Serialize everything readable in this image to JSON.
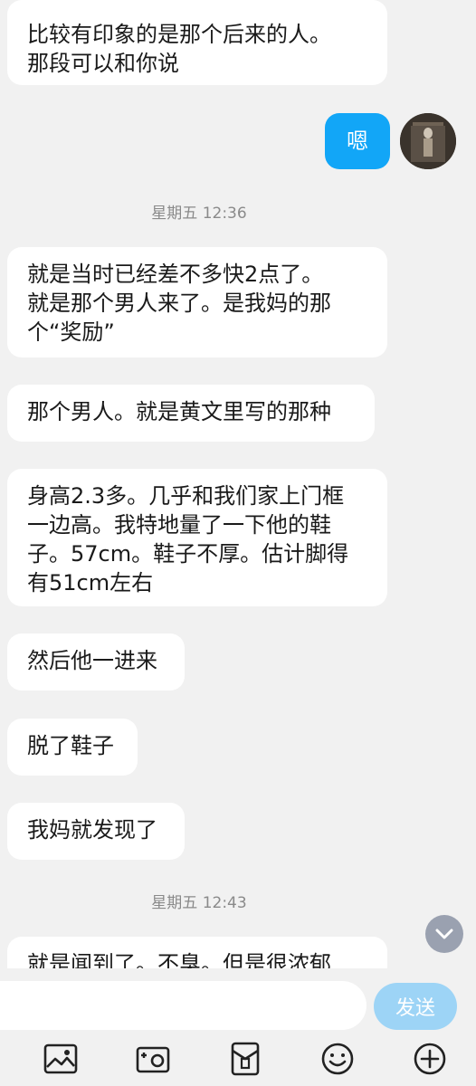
{
  "messages": [
    {
      "text": "比较有印象的是那个后来的人。\n那段可以和你说"
    },
    {
      "text": "嗯"
    },
    {
      "text": "就是当时已经差不多快2点了。\n就是那个男人来了。是我妈的那\n个“奖励”"
    },
    {
      "text": "那个男人。就是黄文里写的那种"
    },
    {
      "text": "身高2.3多。几乎和我们家上门框\n一边高。我特地量了一下他的鞋\n子。57cm。鞋子不厚。估计脚得\n有51cm左右"
    },
    {
      "text": "然后他一进来"
    },
    {
      "text": "脱了鞋子"
    },
    {
      "text": "我妈就发现了"
    },
    {
      "text": "就是闻到了。不臭。但是很浓郁"
    }
  ],
  "timestamps": [
    "星期五 12:36",
    "星期五 12:43"
  ],
  "composer": {
    "placeholder": "",
    "send_label": "发送"
  },
  "colors": {
    "my_bubble": "#12a6f7",
    "send_button": "#9dd4f6",
    "background": "#f1f1f1"
  },
  "icons": [
    "image-icon",
    "camera-icon",
    "red-packet-icon",
    "emoji-icon",
    "plus-icon",
    "chevron-down-icon"
  ]
}
